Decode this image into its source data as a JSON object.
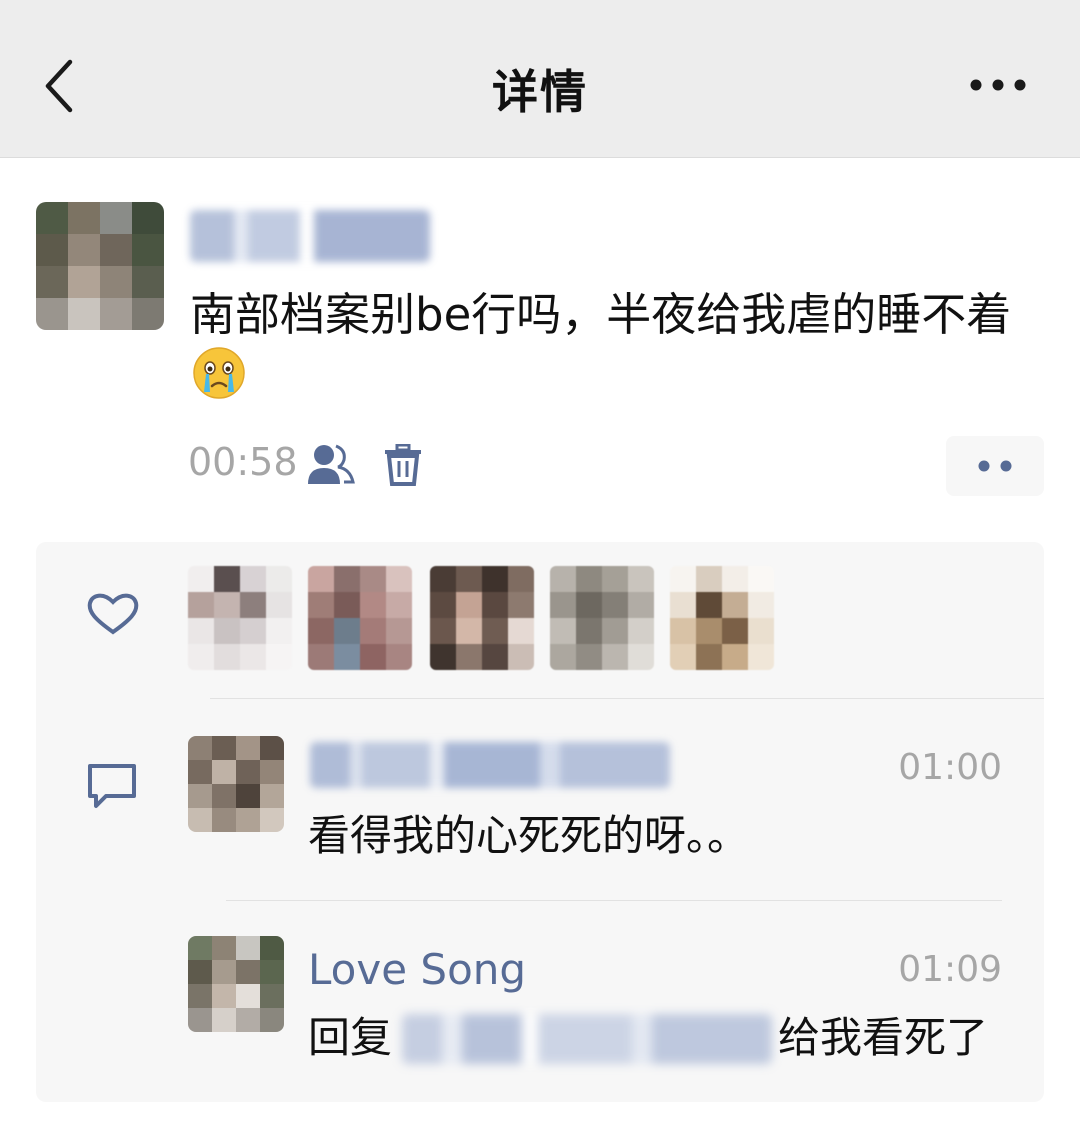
{
  "nav": {
    "title": "详情"
  },
  "post": {
    "text": "南部档案别be行吗，半夜给我虐的睡不着",
    "emoji_icon": "crying-face-emoji",
    "time": "00:58"
  },
  "comments": [
    {
      "name_hidden": true,
      "time": "01:00",
      "text": "看得我的心死死的呀。。"
    },
    {
      "name": "Love Song",
      "time": "01:09",
      "reply_prefix": "回复",
      "reply_suffix": "给我看死了"
    }
  ],
  "colors": {
    "nav_background": "#ededed",
    "link_blue": "#576b95",
    "meta_gray": "#a6a6a6",
    "panel_background": "#f7f7f7"
  },
  "icons": [
    "back-icon",
    "more-icon",
    "friends-icon",
    "trash-icon",
    "heart-icon",
    "comment-icon"
  ]
}
